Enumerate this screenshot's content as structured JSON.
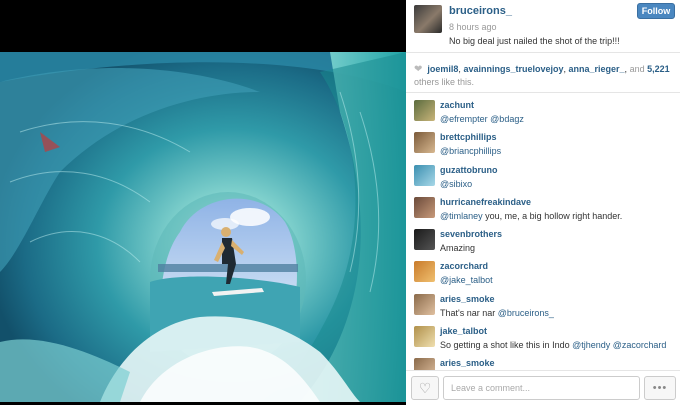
{
  "post": {
    "username": "bruceirons_",
    "time": "8 hours ago",
    "caption": "No big deal just nailed the shot of the trip!!!",
    "follow_label": "Follow"
  },
  "likes": {
    "users": [
      "joemil8",
      "avainnings_truelovejoy",
      "anna_rieger_"
    ],
    "separator": ",",
    "and": "and",
    "count": "5,221",
    "others_text": "others like this."
  },
  "comments": [
    {
      "user": "zachunt",
      "text": "",
      "mentions": [
        "@efrempter",
        "@bdagz"
      ]
    },
    {
      "user": "brettcphillips",
      "text": "",
      "mentions": [
        "@briancphillips"
      ]
    },
    {
      "user": "guzattobruno",
      "text": "",
      "mentions": [
        "@sibixo"
      ]
    },
    {
      "user": "hurricanefreakindave",
      "mention": "@timlaney",
      "text": " you, me, a big hollow right hander."
    },
    {
      "user": "sevenbrothers",
      "text": "Amazing"
    },
    {
      "user": "zacorchard",
      "text": "",
      "mentions": [
        "@jake_talbot"
      ]
    },
    {
      "user": "aries_smoke",
      "text": "That's nar nar ",
      "mention_after": "@bruceirons_"
    },
    {
      "user": "jake_talbot",
      "text": "So getting a shot like this in Indo ",
      "mentions_after": [
        "@tjhendy",
        "@zacorchard"
      ]
    },
    {
      "user": "aries_smoke",
      "text": ""
    }
  ],
  "footer": {
    "comment_placeholder": "Leave a comment...",
    "more_label": "•••"
  },
  "colors": {
    "link": "#2b5f87",
    "follow": "#4a87c0"
  },
  "icons": [
    "heart-icon",
    "heart-outline-icon",
    "more-dots-icon"
  ]
}
